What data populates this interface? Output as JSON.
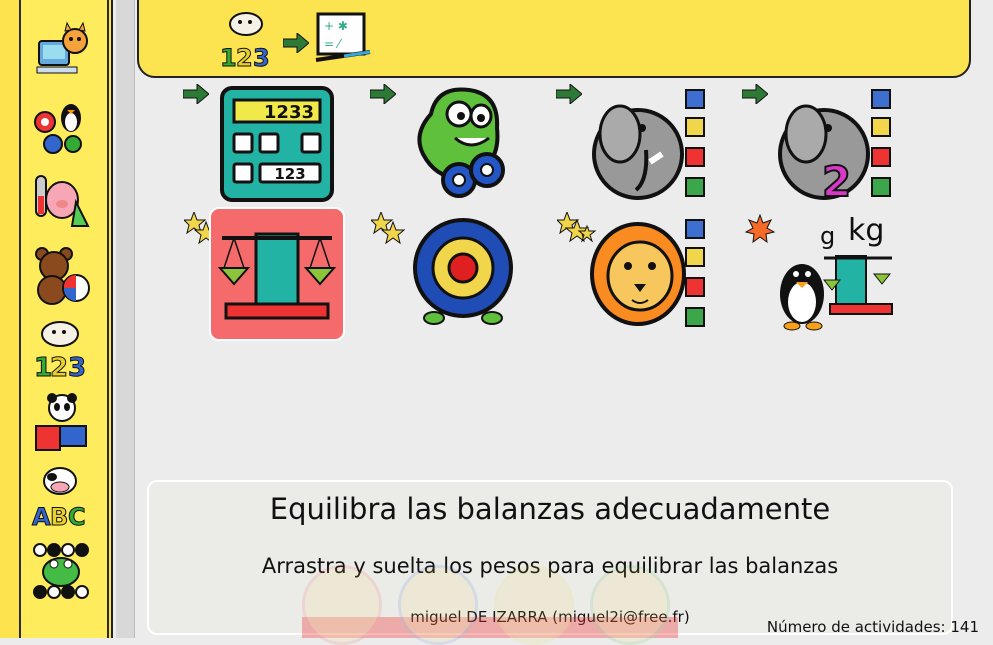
{
  "sidebar": {
    "items": [
      {
        "name": "computer-cat-icon"
      },
      {
        "name": "tux-gears-icon"
      },
      {
        "name": "pig-chemistry-icon"
      },
      {
        "name": "bear-ball-icon"
      },
      {
        "name": "sheep-123-icon"
      },
      {
        "name": "panda-puzzle-icon"
      },
      {
        "name": "cow-abc-icon"
      },
      {
        "name": "frog-board-icon"
      }
    ]
  },
  "breadcrumb": {
    "items": [
      {
        "name": "sheep-123-icon"
      },
      {
        "name": "math-board-icon"
      }
    ]
  },
  "activities": [
    {
      "name": "calculator-icon",
      "display_text": "1233",
      "keys_text": "123"
    },
    {
      "name": "green-monster-icon"
    },
    {
      "name": "elephant-operations-icon"
    },
    {
      "name": "elephant-two-icon",
      "digit": "2"
    },
    {
      "name": "balance-scale-icon",
      "selected": true
    },
    {
      "name": "target-icon"
    },
    {
      "name": "lion-operations-icon"
    },
    {
      "name": "penguin-weights-icon",
      "label_g": "g",
      "label_kg": "kg"
    }
  ],
  "info": {
    "title": "Equilibra las balanzas adecuadamente",
    "description": "Arrastra y suelta los pesos para equilibrar las balanzas",
    "author": "miguel DE IZARRA (miguel2i@free.fr)",
    "activity_count": "Número de actividades: 141"
  },
  "colors": {
    "sidebar": "#ffec5c",
    "topbar": "#fbe44f",
    "selected_bg": "#f56a6a",
    "arrow_green": "#2d7a36"
  }
}
